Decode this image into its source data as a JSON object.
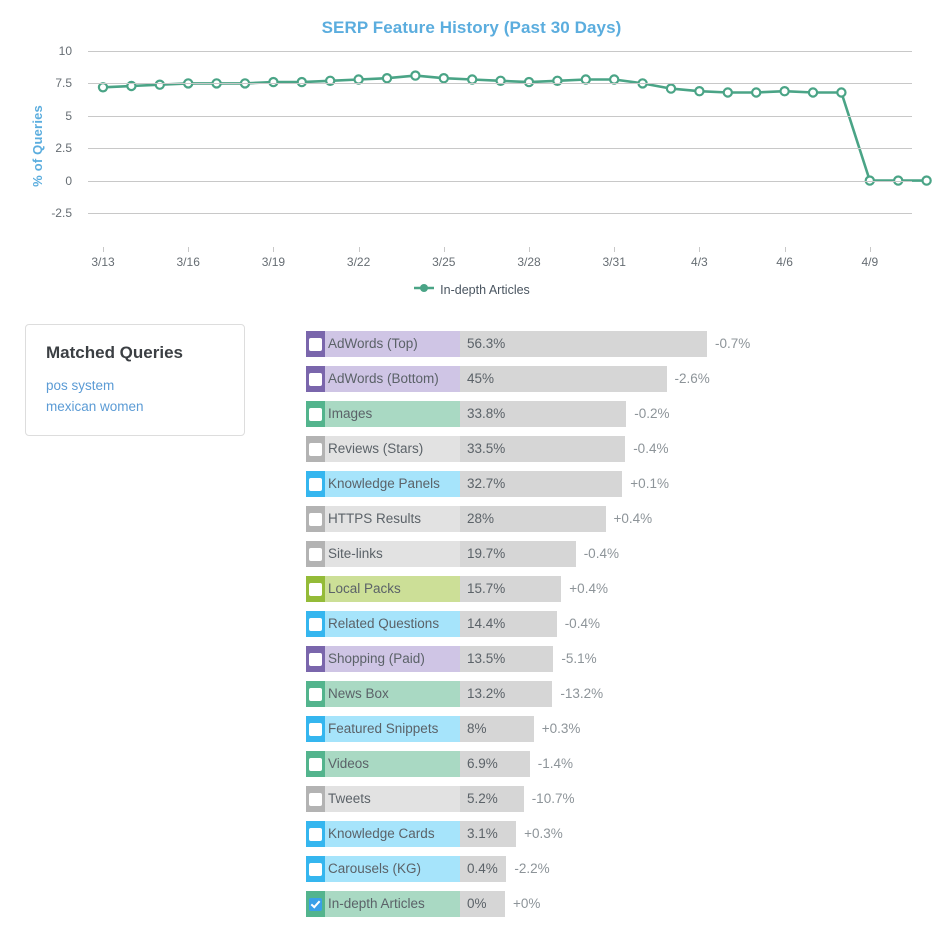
{
  "chart": {
    "title": "SERP Feature History (Past 30 Days)",
    "title_color": "#5badde",
    "ylabel": "% of Queries",
    "legend_label": "In-depth Articles",
    "series_color": "#4aa486"
  },
  "chart_data": {
    "type": "line",
    "title": "SERP Feature History (Past 30 Days)",
    "xlabel": "",
    "ylabel": "% of Queries",
    "ylim": [
      -2.5,
      10
    ],
    "yticks": [
      10,
      7.5,
      5,
      2.5,
      0,
      -2.5
    ],
    "ytick_labels": [
      "10",
      "7.5",
      "5",
      "2.5",
      "0",
      "-2.5"
    ],
    "grid": true,
    "legend_position": "bottom",
    "xtick_labels": [
      "3/13",
      "3/16",
      "3/19",
      "3/22",
      "3/25",
      "3/28",
      "3/31",
      "4/3",
      "4/6",
      "4/9"
    ],
    "x": [
      "3/13",
      "3/14",
      "3/15",
      "3/16",
      "3/17",
      "3/18",
      "3/19",
      "3/20",
      "3/21",
      "3/22",
      "3/23",
      "3/24",
      "3/25",
      "3/26",
      "3/27",
      "3/28",
      "3/29",
      "3/30",
      "3/31",
      "4/1",
      "4/2",
      "4/3",
      "4/4",
      "4/5",
      "4/6",
      "4/7",
      "4/8",
      "4/9",
      "4/10",
      "4/11"
    ],
    "series": [
      {
        "name": "In-depth Articles",
        "color": "#4aa486",
        "values": [
          7.2,
          7.3,
          7.4,
          7.5,
          7.5,
          7.5,
          7.6,
          7.6,
          7.7,
          7.8,
          7.9,
          8.1,
          7.9,
          7.8,
          7.7,
          7.6,
          7.7,
          7.8,
          7.8,
          7.5,
          7.1,
          6.9,
          6.8,
          6.8,
          6.9,
          6.8,
          6.8,
          0,
          0,
          0
        ]
      }
    ]
  },
  "matched_queries": {
    "title": "Matched Queries",
    "queries": [
      "pos system",
      "mexican women"
    ]
  },
  "features": {
    "bar_track_color": "#d6d6d6",
    "max_value": 56.3,
    "rows": [
      {
        "name": "AdWords (Top)",
        "value": "56.3%",
        "num": 56.3,
        "delta": "-0.7%",
        "accent": "#7a66ac",
        "fill": "#cfc5e5"
      },
      {
        "name": "AdWords (Bottom)",
        "value": "45%",
        "num": 45.0,
        "delta": "-2.6%",
        "accent": "#7a66ac",
        "fill": "#cfc5e5"
      },
      {
        "name": "Images",
        "value": "33.8%",
        "num": 33.8,
        "delta": "-0.2%",
        "accent": "#53b48d",
        "fill": "#a9d9c3"
      },
      {
        "name": "Reviews (Stars)",
        "value": "33.5%",
        "num": 33.5,
        "delta": "-0.4%",
        "accent": "#b3b3b3",
        "fill": "#e2e2e2"
      },
      {
        "name": "Knowledge Panels",
        "value": "32.7%",
        "num": 32.7,
        "delta": "+0.1%",
        "accent": "#35b6ef",
        "fill": "#a6e4fb"
      },
      {
        "name": "HTTPS Results",
        "value": "28%",
        "num": 28.0,
        "delta": "+0.4%",
        "accent": "#b3b3b3",
        "fill": "#e2e2e2"
      },
      {
        "name": "Site-links",
        "value": "19.7%",
        "num": 19.7,
        "delta": "-0.4%",
        "accent": "#b3b3b3",
        "fill": "#e2e2e2"
      },
      {
        "name": "Local Packs",
        "value": "15.7%",
        "num": 15.7,
        "delta": "+0.4%",
        "accent": "#94bb38",
        "fill": "#ccdf97"
      },
      {
        "name": "Related Questions",
        "value": "14.4%",
        "num": 14.4,
        "delta": "-0.4%",
        "accent": "#35b6ef",
        "fill": "#a6e4fb"
      },
      {
        "name": "Shopping (Paid)",
        "value": "13.5%",
        "num": 13.5,
        "delta": "-5.1%",
        "accent": "#7a66ac",
        "fill": "#cfc5e5"
      },
      {
        "name": "News Box",
        "value": "13.2%",
        "num": 13.2,
        "delta": "-13.2%",
        "accent": "#53b48d",
        "fill": "#a9d9c3"
      },
      {
        "name": "Featured Snippets",
        "value": "8%",
        "num": 8.0,
        "delta": "+0.3%",
        "accent": "#35b6ef",
        "fill": "#a6e4fb"
      },
      {
        "name": "Videos",
        "value": "6.9%",
        "num": 6.9,
        "delta": "-1.4%",
        "accent": "#53b48d",
        "fill": "#a9d9c3"
      },
      {
        "name": "Tweets",
        "value": "5.2%",
        "num": 5.2,
        "delta": "-10.7%",
        "accent": "#b3b3b3",
        "fill": "#e2e2e2"
      },
      {
        "name": "Knowledge Cards",
        "value": "3.1%",
        "num": 3.1,
        "delta": "+0.3%",
        "accent": "#35b6ef",
        "fill": "#a6e4fb"
      },
      {
        "name": "Carousels (KG)",
        "value": "0.4%",
        "num": 0.4,
        "delta": "-2.2%",
        "accent": "#35b6ef",
        "fill": "#a6e4fb"
      },
      {
        "name": "In-depth Articles",
        "value": "0%",
        "num": 0.0,
        "delta": "+0%",
        "accent": "#53b48d",
        "fill": "#a9d9c3",
        "checked": true
      }
    ]
  }
}
